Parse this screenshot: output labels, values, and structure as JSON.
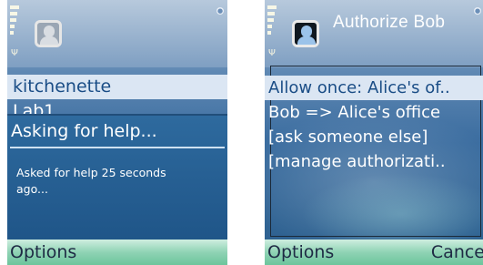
{
  "left_screen": {
    "list_items": [
      "kitchenette",
      "Lab1"
    ],
    "dialog": {
      "title": "Asking for help...",
      "message": "Asked for help 25 seconds ago..."
    },
    "softkeys": {
      "left": "Options"
    }
  },
  "right_screen": {
    "title": "Authorize Bob",
    "list_items": [
      "Allow once: Alice's of..",
      "Bob => Alice's office",
      "[ask someone else]",
      "[manage authorizati.."
    ],
    "selected_index": 0,
    "softkeys": {
      "left": "Options",
      "right": "Cance"
    }
  },
  "icons": {
    "signal": "signal-strength-icon",
    "antenna": "antenna-icon",
    "app": "user-app-icon",
    "status_corner": "status-indicator-icon"
  },
  "colors": {
    "selection_bg": "#dbe6f3",
    "selection_text": "#1a4d86",
    "dialog_bg": "#2e6a9e",
    "softkey_bg": "#8fd3b4"
  }
}
